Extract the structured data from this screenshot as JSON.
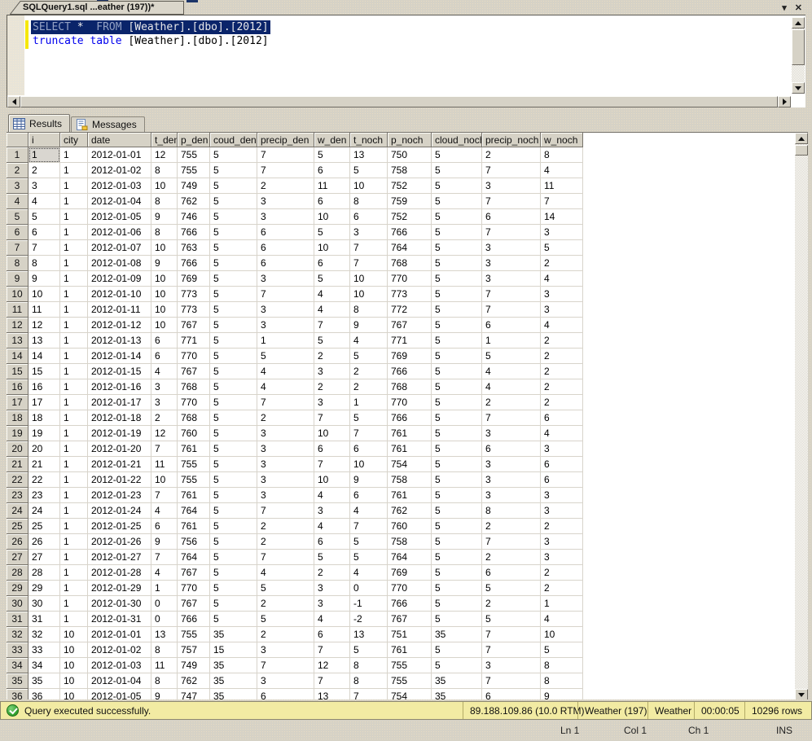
{
  "window": {
    "doc_tab_title": "SQLQuery1.sql ...eather (197))*",
    "icons": {
      "window_dropdown": "▾",
      "window_close": "✕"
    }
  },
  "editor": {
    "lines": [
      {
        "selected": true,
        "segments": [
          {
            "text": "SELECT",
            "type": "keyword"
          },
          {
            "text": " *  ",
            "type": "plain"
          },
          {
            "text": "FROM",
            "type": "keyword"
          },
          {
            "text": " [Weather].[dbo].[2012]",
            "type": "plain"
          }
        ]
      },
      {
        "selected": false,
        "segments": [
          {
            "text": "truncate",
            "type": "keyword"
          },
          {
            "text": " ",
            "type": "plain"
          },
          {
            "text": "table",
            "type": "keyword"
          },
          {
            "text": " [Weather].[dbo].[2012]",
            "type": "plain"
          }
        ]
      }
    ]
  },
  "results_pane": {
    "tabs": [
      {
        "label": "Results",
        "active": true,
        "icon": "results-grid-icon"
      },
      {
        "label": "Messages",
        "active": false,
        "icon": "messages-document-icon"
      }
    ]
  },
  "grid": {
    "columns": [
      "i",
      "city",
      "date",
      "t_den",
      "p_den",
      "coud_den",
      "precip_den",
      "w_den",
      "t_noch",
      "p_noch",
      "cloud_noch",
      "precip_noch",
      "w_noch"
    ],
    "selected_cell": {
      "row": 0,
      "col": 0
    },
    "rows": [
      [
        1,
        1,
        "2012-01-01",
        12,
        755,
        5,
        7,
        5,
        13,
        750,
        5,
        2,
        8
      ],
      [
        2,
        1,
        "2012-01-02",
        8,
        755,
        5,
        7,
        6,
        5,
        758,
        5,
        7,
        4
      ],
      [
        3,
        1,
        "2012-01-03",
        10,
        749,
        5,
        2,
        11,
        10,
        752,
        5,
        3,
        11
      ],
      [
        4,
        1,
        "2012-01-04",
        8,
        762,
        5,
        3,
        6,
        8,
        759,
        5,
        7,
        7
      ],
      [
        5,
        1,
        "2012-01-05",
        9,
        746,
        5,
        3,
        10,
        6,
        752,
        5,
        6,
        14
      ],
      [
        6,
        1,
        "2012-01-06",
        8,
        766,
        5,
        6,
        5,
        3,
        766,
        5,
        7,
        3
      ],
      [
        7,
        1,
        "2012-01-07",
        10,
        763,
        5,
        6,
        10,
        7,
        764,
        5,
        3,
        5
      ],
      [
        8,
        1,
        "2012-01-08",
        9,
        766,
        5,
        6,
        6,
        7,
        768,
        5,
        3,
        2
      ],
      [
        9,
        1,
        "2012-01-09",
        10,
        769,
        5,
        3,
        5,
        10,
        770,
        5,
        3,
        4
      ],
      [
        10,
        1,
        "2012-01-10",
        10,
        773,
        5,
        7,
        4,
        10,
        773,
        5,
        7,
        3
      ],
      [
        11,
        1,
        "2012-01-11",
        10,
        773,
        5,
        3,
        4,
        8,
        772,
        5,
        7,
        3
      ],
      [
        12,
        1,
        "2012-01-12",
        10,
        767,
        5,
        3,
        7,
        9,
        767,
        5,
        6,
        4
      ],
      [
        13,
        1,
        "2012-01-13",
        6,
        771,
        5,
        1,
        5,
        4,
        771,
        5,
        1,
        2
      ],
      [
        14,
        1,
        "2012-01-14",
        6,
        770,
        5,
        5,
        2,
        5,
        769,
        5,
        5,
        2
      ],
      [
        15,
        1,
        "2012-01-15",
        4,
        767,
        5,
        4,
        3,
        2,
        766,
        5,
        4,
        2
      ],
      [
        16,
        1,
        "2012-01-16",
        3,
        768,
        5,
        4,
        2,
        2,
        768,
        5,
        4,
        2
      ],
      [
        17,
        1,
        "2012-01-17",
        3,
        770,
        5,
        7,
        3,
        1,
        770,
        5,
        2,
        2
      ],
      [
        18,
        1,
        "2012-01-18",
        2,
        768,
        5,
        2,
        7,
        5,
        766,
        5,
        7,
        6
      ],
      [
        19,
        1,
        "2012-01-19",
        12,
        760,
        5,
        3,
        10,
        7,
        761,
        5,
        3,
        4
      ],
      [
        20,
        1,
        "2012-01-20",
        7,
        761,
        5,
        3,
        6,
        6,
        761,
        5,
        6,
        3
      ],
      [
        21,
        1,
        "2012-01-21",
        11,
        755,
        5,
        3,
        7,
        10,
        754,
        5,
        3,
        6
      ],
      [
        22,
        1,
        "2012-01-22",
        10,
        755,
        5,
        3,
        10,
        9,
        758,
        5,
        3,
        6
      ],
      [
        23,
        1,
        "2012-01-23",
        7,
        761,
        5,
        3,
        4,
        6,
        761,
        5,
        3,
        3
      ],
      [
        24,
        1,
        "2012-01-24",
        4,
        764,
        5,
        7,
        3,
        4,
        762,
        5,
        8,
        3
      ],
      [
        25,
        1,
        "2012-01-25",
        6,
        761,
        5,
        2,
        4,
        7,
        760,
        5,
        2,
        2
      ],
      [
        26,
        1,
        "2012-01-26",
        9,
        756,
        5,
        2,
        6,
        5,
        758,
        5,
        7,
        3
      ],
      [
        27,
        1,
        "2012-01-27",
        7,
        764,
        5,
        7,
        5,
        5,
        764,
        5,
        2,
        3
      ],
      [
        28,
        1,
        "2012-01-28",
        4,
        767,
        5,
        4,
        2,
        4,
        769,
        5,
        6,
        2
      ],
      [
        29,
        1,
        "2012-01-29",
        1,
        770,
        5,
        5,
        3,
        0,
        770,
        5,
        5,
        2
      ],
      [
        30,
        1,
        "2012-01-30",
        0,
        767,
        5,
        2,
        3,
        -1,
        766,
        5,
        2,
        1
      ],
      [
        31,
        1,
        "2012-01-31",
        0,
        766,
        5,
        5,
        4,
        -2,
        767,
        5,
        5,
        4
      ],
      [
        32,
        10,
        "2012-01-01",
        13,
        755,
        35,
        2,
        6,
        13,
        751,
        35,
        7,
        10
      ],
      [
        33,
        10,
        "2012-01-02",
        8,
        757,
        15,
        3,
        7,
        5,
        761,
        5,
        7,
        5
      ],
      [
        34,
        10,
        "2012-01-03",
        11,
        749,
        35,
        7,
        12,
        8,
        755,
        5,
        3,
        8
      ],
      [
        35,
        10,
        "2012-01-04",
        8,
        762,
        35,
        3,
        7,
        8,
        755,
        35,
        7,
        8
      ],
      [
        36,
        10,
        "2012-01-05",
        9,
        747,
        35,
        6,
        13,
        7,
        754,
        35,
        6,
        9
      ]
    ]
  },
  "status_bar": {
    "message": "Query executed successfully.",
    "server": "89.188.109.86 (10.0 RTM)",
    "login": "Weather (197)",
    "database": "Weather",
    "duration": "00:00:05",
    "row_count": "10296 rows",
    "success_color": "#2f9e2b",
    "bar_color": "#f2eba3"
  },
  "bottom_bar": {
    "line": "Ln 1",
    "column": "Col 1",
    "char": "Ch 1",
    "mode": "INS"
  },
  "colors": {
    "selection_background": "#0a246a",
    "keyword_blue": "#0000ee",
    "chrome_gray": "#d6d2c6",
    "change_bar_yellow": "#f5e70a"
  }
}
